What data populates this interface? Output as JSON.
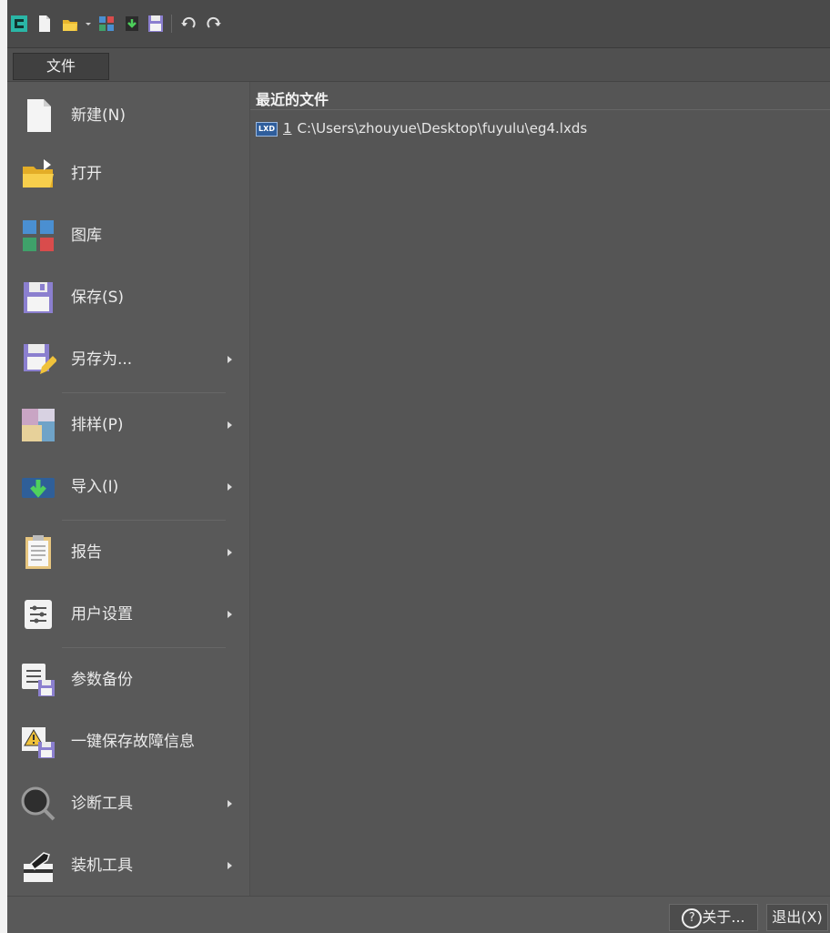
{
  "file_tab": "文件",
  "menu": [
    {
      "label": "新建(N)",
      "icon": "new-file-icon",
      "arrow": false
    },
    {
      "label": "打开",
      "icon": "open-folder-icon",
      "arrow": false
    },
    {
      "label": "图库",
      "icon": "gallery-icon",
      "arrow": false
    },
    {
      "label": "保存(S)",
      "icon": "save-icon",
      "arrow": false
    },
    {
      "label": "另存为...",
      "icon": "save-as-icon",
      "arrow": true
    },
    {
      "label": "排样(P)",
      "icon": "nesting-icon",
      "arrow": true
    },
    {
      "label": "导入(I)",
      "icon": "import-icon",
      "arrow": true
    },
    {
      "label": "报告",
      "icon": "report-icon",
      "arrow": true
    },
    {
      "label": "用户设置",
      "icon": "user-settings-icon",
      "arrow": true
    },
    {
      "label": "参数备份",
      "icon": "parameter-backup-icon",
      "arrow": false
    },
    {
      "label": "一键保存故障信息",
      "icon": "save-fault-info-icon",
      "arrow": false
    },
    {
      "label": "诊断工具",
      "icon": "diagnostic-icon",
      "arrow": true
    },
    {
      "label": "装机工具",
      "icon": "install-tool-icon",
      "arrow": true
    }
  ],
  "recent": {
    "title": "最近的文件",
    "files": [
      {
        "num": "1",
        "path": "C:\\Users\\zhouyue\\Desktop\\fuyulu\\eg4.lxds",
        "badge": "LXD"
      }
    ]
  },
  "footer": {
    "about": "关于...",
    "exit": "退出(X)"
  }
}
